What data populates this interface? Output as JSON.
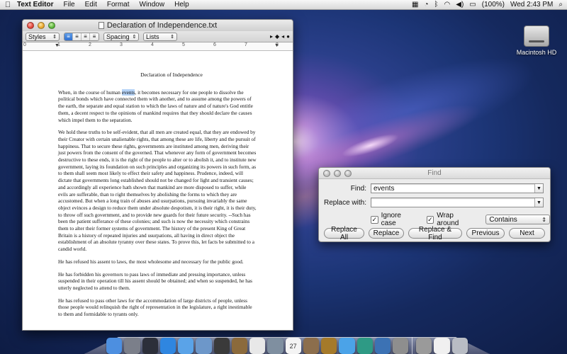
{
  "menubar": {
    "app_name": "Text Editor",
    "menus": [
      "File",
      "Edit",
      "Format",
      "Window",
      "Help"
    ],
    "battery": "(100%)",
    "clock": "Wed 2:43 PM"
  },
  "editor": {
    "window_title": "Declaration of Independence.txt",
    "toolbar": {
      "styles_label": "Styles",
      "spacing_label": "Spacing",
      "lists_label": "Lists"
    },
    "ruler_numbers": [
      "0",
      "1",
      "2",
      "3",
      "4",
      "5",
      "6",
      "7",
      "8"
    ],
    "document": {
      "title": "Declaration of Independence",
      "p1_before": "When, in the course of human ",
      "p1_highlight": "events",
      "p1_after": ", it becomes necessary for one people to dissolve the political bonds which have connected them with another, and to assume among the powers of the earth, the separate and equal station to which the laws of nature and of nature's God entitle them, a decent respect to the opinions of mankind requires that they should declare the causes which impel them to the separation.",
      "p2": "We hold these truths to be self-evident, that all men are created equal, that they are endowed by their Creator with certain unalienable rights, that among these are life, liberty and the pursuit of happiness. That to secure these rights, governments are instituted among men, deriving their just powers from the consent of the governed. That whenever any form of government becomes destructive to these ends, it is the right of the people to alter or to abolish it, and to institute new government, laying its foundation on such principles and organizing its powers in such form, as to them shall seem most likely to effect their safety and happiness. Prudence, indeed, will dictate that governments long established should not be changed for light and transient causes; and accordingly all experience hath shown that mankind are more disposed to suffer, while evils are sufferable, than to right themselves by abolishing the forms to which they are accustomed. But when a long train of abuses and usurpations, pursuing invariably the same object evinces a design to reduce them under absolute despotism, it is their right, it is their duty, to throw off such government, and to provide new guards for their future security. --Such has been the patient sufferance of these colonies; and such is now the necessity which constrains them to alter their former systems of government. The history of the present King of Great Britain is a history of repeated injuries and usurpations, all having in direct object the establishment of an absolute tyranny over these states. To prove this, let facts be submitted to a candid world.",
      "p3": "He has refused his assent to laws, the most wholesome and necessary for the public good.",
      "p4": "He has forbidden his governors to pass laws of immediate and pressing importance, unless suspended in their operation till his assent should be obtained; and when so suspended, he has utterly neglected to attend to them.",
      "p5": "He has refused to pass other laws for the accommodation of large districts of people, unless those people would relinquish the right of representation in the legislature, a right inestimable to them and formidable to tyrants only."
    }
  },
  "find_panel": {
    "title": "Find",
    "find_label": "Find:",
    "find_value": "events",
    "replace_label": "Replace with:",
    "replace_value": "",
    "ignore_case_label": "Ignore case",
    "ignore_case_checked": true,
    "wrap_around_label": "Wrap around",
    "wrap_around_checked": true,
    "match_mode": "Contains",
    "buttons": {
      "replace_all": "Replace All",
      "replace": "Replace",
      "replace_find": "Replace & Find",
      "previous": "Previous",
      "next": "Next"
    }
  },
  "desktop": {
    "drive_label": "Macintosh HD"
  },
  "dock": {
    "items": [
      {
        "name": "finder-icon",
        "color": "#4d8fe0"
      },
      {
        "name": "launchpad-icon",
        "color": "#7b7f8a"
      },
      {
        "name": "mission-control-icon",
        "color": "#2c2f3a"
      },
      {
        "name": "app-store-icon",
        "color": "#2f86e0"
      },
      {
        "name": "safari-icon",
        "color": "#5aa3e8"
      },
      {
        "name": "mail-icon",
        "color": "#6d97c9"
      },
      {
        "name": "facetime-icon",
        "color": "#3a3a3a"
      },
      {
        "name": "address-book-icon",
        "color": "#8b6a3c"
      },
      {
        "name": "textedit-icon",
        "color": "#e8e8e8"
      },
      {
        "name": "road-icon",
        "color": "#7f8fa0"
      },
      {
        "name": "ical-icon",
        "color": "#f4f4f4",
        "text": "27"
      },
      {
        "name": "preview-icon",
        "color": "#8c6e4c"
      },
      {
        "name": "iphoto-icon",
        "color": "#a57a2a"
      },
      {
        "name": "itunes-icon",
        "color": "#4ba3e8"
      },
      {
        "name": "time-machine-icon",
        "color": "#2e9a85"
      },
      {
        "name": "xcode-icon",
        "color": "#3c72b4"
      },
      {
        "name": "system-preferences-icon",
        "color": "#8e8e8e"
      },
      {
        "name": "downloads-icon",
        "color": "#9a9a9a"
      },
      {
        "name": "document-icon",
        "color": "#f0f0f0"
      },
      {
        "name": "trash-icon",
        "color": "#b8bcc4"
      }
    ]
  }
}
